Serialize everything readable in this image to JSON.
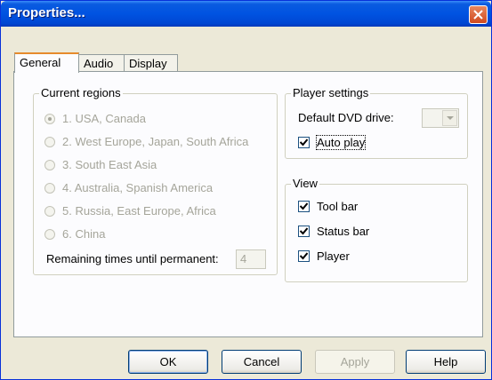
{
  "window": {
    "title": "Properties..."
  },
  "tabs": [
    {
      "label": "General",
      "active": true
    },
    {
      "label": "Audio",
      "active": false
    },
    {
      "label": "Display",
      "active": false
    }
  ],
  "regions": {
    "title": "Current regions",
    "options": [
      {
        "label": "1. USA, Canada",
        "selected": true
      },
      {
        "label": "2. West Europe, Japan, South Africa",
        "selected": false
      },
      {
        "label": "3. South East Asia",
        "selected": false
      },
      {
        "label": "4. Australia, Spanish America",
        "selected": false
      },
      {
        "label": "5. Russia, East Europe, Africa",
        "selected": false
      },
      {
        "label": "6. China",
        "selected": false
      }
    ],
    "remaining_label": "Remaining times until permanent:",
    "remaining_value": "4"
  },
  "player_settings": {
    "title": "Player settings",
    "drive_label": "Default DVD drive:",
    "drive_value": "",
    "auto_play_label": "Auto play",
    "auto_play_checked": true
  },
  "view": {
    "title": "View",
    "items": [
      {
        "label": "Tool bar",
        "checked": true
      },
      {
        "label": "Status bar",
        "checked": true
      },
      {
        "label": "Player",
        "checked": true
      }
    ]
  },
  "buttons": {
    "ok": "OK",
    "cancel": "Cancel",
    "apply": "Apply",
    "help": "Help"
  },
  "colors": {
    "titlebar": "#0053e1",
    "dialog_bg": "#ece9d8",
    "close_button": "#d04a1f",
    "tab_highlight": "#e68b2c"
  }
}
